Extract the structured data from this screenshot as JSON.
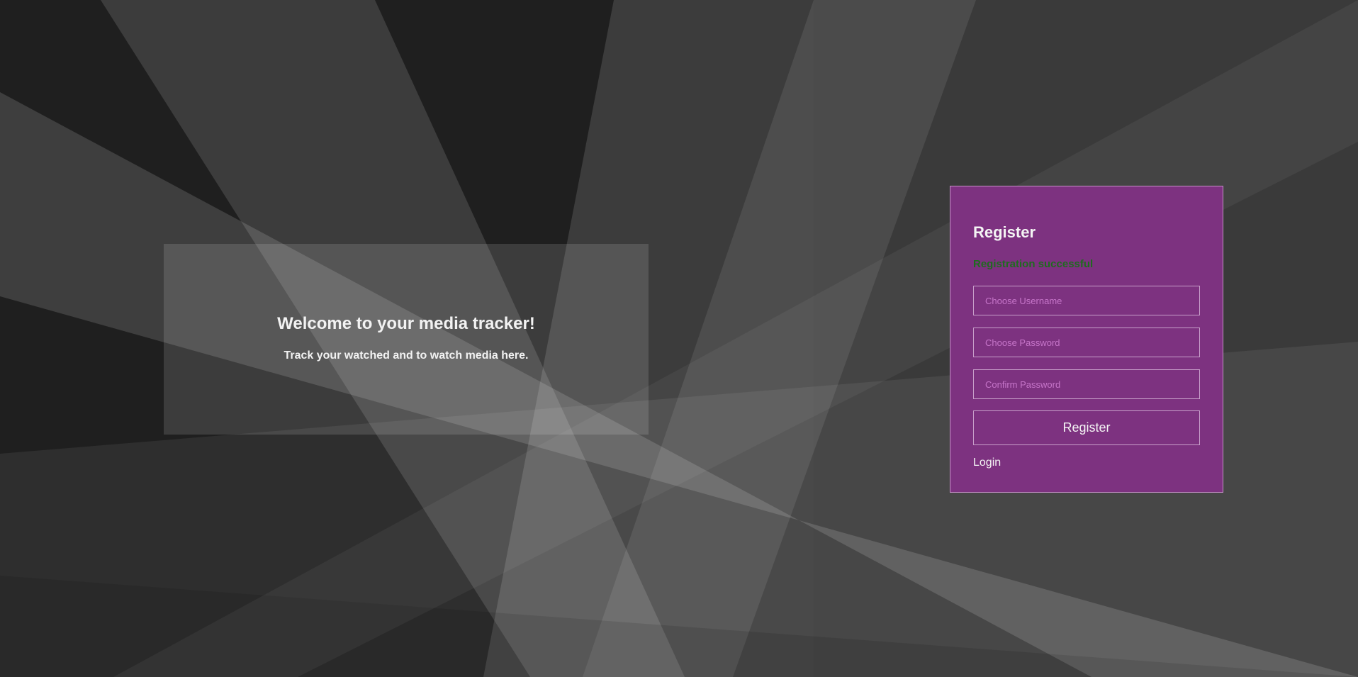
{
  "welcome": {
    "title": "Welcome to your media tracker!",
    "subtitle": "Track your watched and to watch media here."
  },
  "register": {
    "title": "Register",
    "success_message": "Registration successful",
    "username_placeholder": "Choose Username",
    "password_placeholder": "Choose Password",
    "confirm_placeholder": "Confirm Password",
    "button_label": "Register",
    "login_link": "Login"
  },
  "colors": {
    "background": "#1f1f1f",
    "card": "#7d3280",
    "card_border": "#c491c6",
    "success": "#1f6b1f",
    "placeholder": "#c675c9"
  }
}
